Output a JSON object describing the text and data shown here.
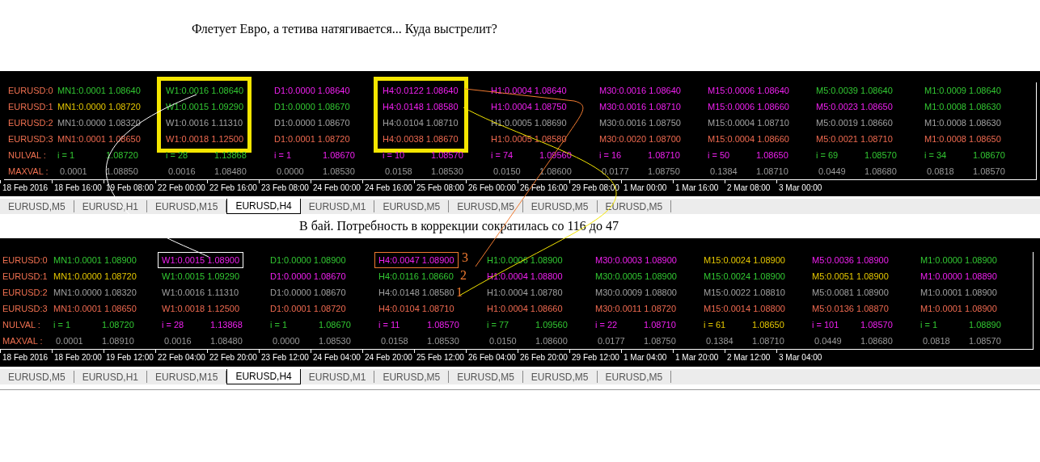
{
  "heading": "Флетует Евро, а тетива натягивается... Куда выстрелит?",
  "panels": [
    {
      "row_labels": [
        "EURUSD:0",
        "EURUSD:1",
        "EURUSD:2",
        "EURUSD:3",
        "NULVAL :",
        "MAXVAL :"
      ],
      "columns": [
        {
          "rows": [
            {
              "text": "MN1:0.0001 1.08640",
              "color": "#32c832"
            },
            {
              "text": "MN1:0.0000 1.08720",
              "color": "#e6c800"
            },
            {
              "text": "MN1:0.0000 1.08320",
              "color": "#a0a0a0"
            },
            {
              "text": "MN1:0.0001 1.08650",
              "color": "#f06a50"
            }
          ],
          "nulval": {
            "index": "i = 1",
            "value": "1.08720",
            "color": "#32c832"
          },
          "maxval": {
            "first": "0.0001",
            "second": "1.08850"
          }
        },
        {
          "rows": [
            {
              "text": "W1:0.0016 1.08640",
              "color": "#32c832"
            },
            {
              "text": "W1:0.0015 1.09290",
              "color": "#32c832"
            },
            {
              "text": "W1:0.0016 1.11310",
              "color": "#a0a0a0"
            },
            {
              "text": "W1:0.0018 1.12500",
              "color": "#f06a50"
            }
          ],
          "nulval": {
            "index": "i = 28",
            "value": "1.13868",
            "color": "#32c832"
          },
          "maxval": {
            "first": "0.0016",
            "second": "1.08480"
          },
          "frame": {
            "kind": "block",
            "color": "#f5e600"
          }
        },
        {
          "rows": [
            {
              "text": "D1:0.0000 1.08640",
              "color": "#f020f0"
            },
            {
              "text": "D1:0.0000 1.08670",
              "color": "#32c832"
            },
            {
              "text": "D1:0.0000 1.08670",
              "color": "#a0a0a0"
            },
            {
              "text": "D1:0.0001 1.08720",
              "color": "#f06a50"
            }
          ],
          "nulval": {
            "index": "i = 1",
            "value": "1.08670",
            "color": "#f020f0"
          },
          "maxval": {
            "first": "0.0000",
            "second": "1.08530"
          }
        },
        {
          "rows": [
            {
              "text": "H4:0.0122 1.08640",
              "color": "#f020f0"
            },
            {
              "text": "H4:0.0148 1.08580",
              "color": "#f020f0"
            },
            {
              "text": "H4:0.0104 1.08710",
              "color": "#a0a0a0"
            },
            {
              "text": "H4:0.0038 1.08670",
              "color": "#f06a50"
            }
          ],
          "nulval": {
            "index": "i = 10",
            "value": "1.08570",
            "color": "#f020f0"
          },
          "maxval": {
            "first": "0.0158",
            "second": "1.08530"
          },
          "frame": {
            "kind": "block",
            "color": "#f5e600"
          }
        },
        {
          "rows": [
            {
              "text": "H1:0.0004 1.08640",
              "color": "#f020f0"
            },
            {
              "text": "H1:0.0004 1.08750",
              "color": "#f020f0"
            },
            {
              "text": "H1:0.0005 1.08690",
              "color": "#a0a0a0"
            },
            {
              "text": "H1:0.0005 1.08580",
              "color": "#f06a50"
            }
          ],
          "nulval": {
            "index": "i = 74",
            "value": "1.09560",
            "color": "#f020f0"
          },
          "maxval": {
            "first": "0.0150",
            "second": "1.08600"
          }
        },
        {
          "rows": [
            {
              "text": "M30:0.0016 1.08640",
              "color": "#f020f0"
            },
            {
              "text": "M30:0.0016 1.08710",
              "color": "#f020f0"
            },
            {
              "text": "M30:0.0016 1.08750",
              "color": "#a0a0a0"
            },
            {
              "text": "M30:0.0020 1.08700",
              "color": "#f06a50"
            }
          ],
          "nulval": {
            "index": "i = 16",
            "value": "1.08710",
            "color": "#f020f0"
          },
          "maxval": {
            "first": "0.0177",
            "second": "1.08750"
          }
        },
        {
          "rows": [
            {
              "text": "M15:0.0006 1.08640",
              "color": "#f020f0"
            },
            {
              "text": "M15:0.0006 1.08660",
              "color": "#f020f0"
            },
            {
              "text": "M15:0.0004 1.08710",
              "color": "#a0a0a0"
            },
            {
              "text": "M15:0.0004 1.08660",
              "color": "#f06a50"
            }
          ],
          "nulval": {
            "index": "i = 50",
            "value": "1.08650",
            "color": "#f020f0"
          },
          "maxval": {
            "first": "0.1384",
            "second": "1.08710"
          }
        },
        {
          "rows": [
            {
              "text": "M5:0.0039 1.08640",
              "color": "#32c832"
            },
            {
              "text": "M5:0.0023 1.08650",
              "color": "#f020f0"
            },
            {
              "text": "M5:0.0019 1.08660",
              "color": "#a0a0a0"
            },
            {
              "text": "M5:0.0021 1.08710",
              "color": "#f06a50"
            }
          ],
          "nulval": {
            "index": "i = 69",
            "value": "1.08570",
            "color": "#32c832"
          },
          "maxval": {
            "first": "0.0449",
            "second": "1.08680"
          }
        },
        {
          "rows": [
            {
              "text": "M1:0.0009 1.08640",
              "color": "#32c832"
            },
            {
              "text": "M1:0.0008 1.08630",
              "color": "#32c832"
            },
            {
              "text": "M1:0.0008 1.08630",
              "color": "#a0a0a0"
            },
            {
              "text": "M1:0.0008 1.08650",
              "color": "#f06a50"
            }
          ],
          "nulval": {
            "index": "i = 34",
            "value": "1.08670",
            "color": "#32c832"
          },
          "maxval": {
            "first": "0.0818",
            "second": "1.08570"
          }
        }
      ],
      "time_axis": [
        "18 Feb 2016",
        "18 Feb 16:00",
        "19 Feb 08:00",
        "22 Feb 00:00",
        "22 Feb 16:00",
        "23 Feb 08:00",
        "24 Feb 00:00",
        "24 Feb 16:00",
        "25 Feb 08:00",
        "26 Feb 00:00",
        "26 Feb 16:00",
        "29 Feb 08:00",
        "1 Mar 00:00",
        "1 Mar 16:00",
        "2 Mar 08:00",
        "3 Mar 00:00"
      ],
      "tabs": [
        {
          "label": "EURUSD,M5",
          "selected": false
        },
        {
          "label": "EURUSD,H1",
          "selected": false
        },
        {
          "label": "EURUSD,M15",
          "selected": false
        },
        {
          "label": "EURUSD,H4",
          "selected": true
        },
        {
          "label": "EURUSD,M1",
          "selected": false
        },
        {
          "label": "EURUSD,M5",
          "selected": false
        },
        {
          "label": "EURUSD,M5",
          "selected": false
        },
        {
          "label": "EURUSD,M5",
          "selected": false
        },
        {
          "label": "EURUSD,M5",
          "selected": false
        }
      ]
    },
    {
      "caption": "В бай. Потребность в коррекции сократилась со 116 до 47",
      "row_labels": [
        "EURUSD:0",
        "EURUSD:1",
        "EURUSD:2",
        "EURUSD:3",
        "NULVAL :",
        "MAXVAL :"
      ],
      "columns": [
        {
          "rows": [
            {
              "text": "MN1:0.0001 1.08900",
              "color": "#32c832"
            },
            {
              "text": "MN1:0.0000 1.08720",
              "color": "#e6c800"
            },
            {
              "text": "MN1:0.0000 1.08320",
              "color": "#a0a0a0"
            },
            {
              "text": "MN1:0.0001 1.08650",
              "color": "#f06a50"
            }
          ],
          "nulval": {
            "index": "i = 1",
            "value": "1.08720",
            "color": "#32c832"
          },
          "maxval": {
            "first": "0.0001",
            "second": "1.08910"
          }
        },
        {
          "rows": [
            {
              "text": "W1:0.0015 1.08900",
              "color": "#f020f0"
            },
            {
              "text": "W1:0.0015 1.09290",
              "color": "#32c832"
            },
            {
              "text": "W1:0.0016 1.11310",
              "color": "#a0a0a0"
            },
            {
              "text": "W1:0.0018 1.12500",
              "color": "#f06a50"
            }
          ],
          "nulval": {
            "index": "i = 28",
            "value": "1.13868",
            "color": "#f020f0"
          },
          "maxval": {
            "first": "0.0016",
            "second": "1.08480"
          },
          "frame": {
            "kind": "first",
            "color": "#ffffff"
          }
        },
        {
          "rows": [
            {
              "text": "D1:0.0000 1.08900",
              "color": "#32c832"
            },
            {
              "text": "D1:0.0000 1.08670",
              "color": "#f020f0"
            },
            {
              "text": "D1:0.0000 1.08670",
              "color": "#a0a0a0"
            },
            {
              "text": "D1:0.0001 1.08720",
              "color": "#f06a50"
            }
          ],
          "nulval": {
            "index": "i = 1",
            "value": "1.08670",
            "color": "#32c832"
          },
          "maxval": {
            "first": "0.0000",
            "second": "1.08530"
          }
        },
        {
          "rows": [
            {
              "text": "H4:0.0047 1.08900",
              "color": "#f020f0"
            },
            {
              "text": "H4:0.0116 1.08660",
              "color": "#32c832"
            },
            {
              "text": "H4:0.0148 1.08580",
              "color": "#a0a0a0"
            },
            {
              "text": "H4:0.0104 1.08710",
              "color": "#f06a50"
            }
          ],
          "nulval": {
            "index": "i = 11",
            "value": "1.08570",
            "color": "#f020f0"
          },
          "maxval": {
            "first": "0.0158",
            "second": "1.08530"
          },
          "frame": {
            "kind": "first",
            "color": "#f07a30"
          }
        },
        {
          "rows": [
            {
              "text": "H1:0.0006 1.08900",
              "color": "#32c832"
            },
            {
              "text": "H1:0.0004 1.08800",
              "color": "#f020f0"
            },
            {
              "text": "H1:0.0004 1.08780",
              "color": "#a0a0a0"
            },
            {
              "text": "H1:0.0004 1.08660",
              "color": "#f06a50"
            }
          ],
          "nulval": {
            "index": "i = 77",
            "value": "1.09560",
            "color": "#32c832"
          },
          "maxval": {
            "first": "0.0150",
            "second": "1.08600"
          }
        },
        {
          "rows": [
            {
              "text": "M30:0.0003 1.08900",
              "color": "#f020f0"
            },
            {
              "text": "M30:0.0005 1.08900",
              "color": "#32c832"
            },
            {
              "text": "M30:0.0009 1.08800",
              "color": "#a0a0a0"
            },
            {
              "text": "M30:0.0011 1.08720",
              "color": "#f06a50"
            }
          ],
          "nulval": {
            "index": "i = 22",
            "value": "1.08710",
            "color": "#f020f0"
          },
          "maxval": {
            "first": "0.0177",
            "second": "1.08750"
          }
        },
        {
          "rows": [
            {
              "text": "M15:0.0024 1.08900",
              "color": "#e6c800"
            },
            {
              "text": "M15:0.0024 1.08900",
              "color": "#32c832"
            },
            {
              "text": "M15:0.0022 1.08810",
              "color": "#a0a0a0"
            },
            {
              "text": "M15:0.0014 1.08800",
              "color": "#f06a50"
            }
          ],
          "nulval": {
            "index": "i = 61",
            "value": "1.08650",
            "color": "#e6c800"
          },
          "maxval": {
            "first": "0.1384",
            "second": "1.08710"
          }
        },
        {
          "rows": [
            {
              "text": "M5:0.0036 1.08900",
              "color": "#f020f0"
            },
            {
              "text": "M5:0.0051 1.08900",
              "color": "#e6c800"
            },
            {
              "text": "M5:0.0081 1.08900",
              "color": "#a0a0a0"
            },
            {
              "text": "M5:0.0136 1.08870",
              "color": "#f06a50"
            }
          ],
          "nulval": {
            "index": "i = 101",
            "value": "1.08570",
            "color": "#f020f0"
          },
          "maxval": {
            "first": "0.0449",
            "second": "1.08680"
          }
        },
        {
          "rows": [
            {
              "text": "M1:0.0000 1.08900",
              "color": "#32c832"
            },
            {
              "text": "M1:0.0000 1.08890",
              "color": "#f020f0"
            },
            {
              "text": "M1:0.0001 1.08900",
              "color": "#a0a0a0"
            },
            {
              "text": "M1:0.0001 1.08900",
              "color": "#f06a50"
            }
          ],
          "nulval": {
            "index": "i = 1",
            "value": "1.08890",
            "color": "#32c832"
          },
          "maxval": {
            "first": "0.0818",
            "second": "1.08570"
          }
        }
      ],
      "time_axis": [
        "18 Feb 2016",
        "18 Feb 20:00",
        "19 Feb 12:00",
        "22 Feb 04:00",
        "22 Feb 20:00",
        "23 Feb 12:00",
        "24 Feb 04:00",
        "24 Feb 20:00",
        "25 Feb 12:00",
        "26 Feb 04:00",
        "26 Feb 20:00",
        "29 Feb 12:00",
        "1 Mar 04:00",
        "1 Mar 20:00",
        "2 Mar 12:00",
        "3 Mar 04:00"
      ],
      "tabs": [
        {
          "label": "EURUSD,M5",
          "selected": false
        },
        {
          "label": "EURUSD,H1",
          "selected": false
        },
        {
          "label": "EURUSD,M15",
          "selected": false
        },
        {
          "label": "EURUSD,H4",
          "selected": true
        },
        {
          "label": "EURUSD,M1",
          "selected": false
        },
        {
          "label": "EURUSD,M5",
          "selected": false
        },
        {
          "label": "EURUSD,M5",
          "selected": false
        },
        {
          "label": "EURUSD,M5",
          "selected": false
        },
        {
          "label": "EURUSD,M5",
          "selected": false
        }
      ]
    }
  ],
  "annotation_marks": [
    "3",
    "2",
    "1"
  ]
}
